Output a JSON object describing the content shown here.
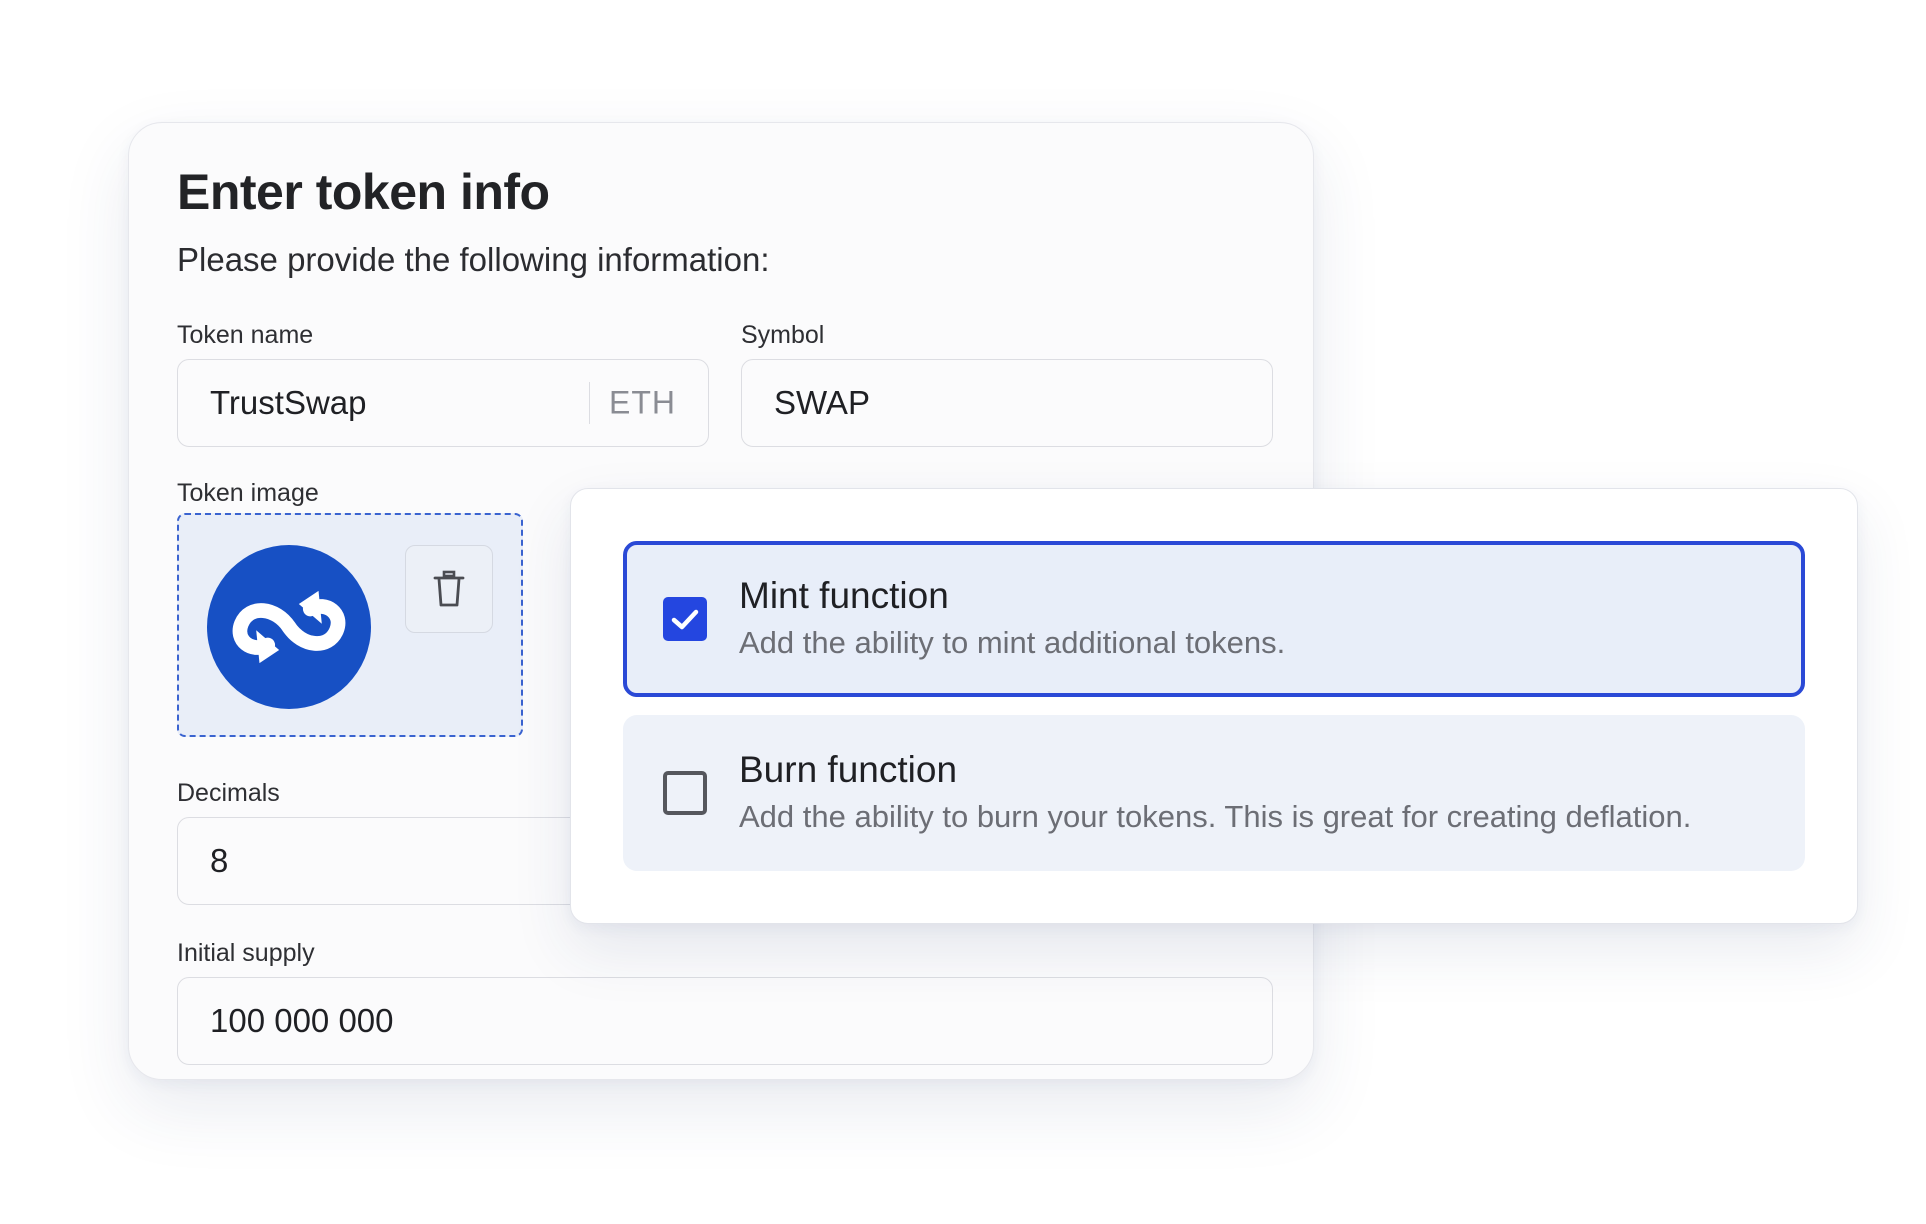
{
  "form": {
    "title": "Enter token info",
    "subtitle": "Please provide the following information:",
    "token_name": {
      "label": "Token name",
      "value": "TrustSwap",
      "suffix": "ETH"
    },
    "symbol": {
      "label": "Symbol",
      "value": "SWAP"
    },
    "token_image": {
      "label": "Token image",
      "icon": "trustswap-logo",
      "delete_icon": "trash-icon"
    },
    "decimals": {
      "label": "Decimals",
      "value": "8"
    },
    "initial_supply": {
      "label": "Initial supply",
      "value": "100 000 000"
    }
  },
  "options": [
    {
      "title": "Mint function",
      "description": "Add the ability to mint additional tokens.",
      "checked": true
    },
    {
      "title": "Burn function",
      "description": "Add the ability to burn your tokens. This is great for creating deflation.",
      "checked": false
    }
  ],
  "colors": {
    "accent": "#2446e0",
    "logo_blue": "#1750c4",
    "selected_bg": "#e8eef9",
    "dropzone_bg": "#e9eef8"
  }
}
